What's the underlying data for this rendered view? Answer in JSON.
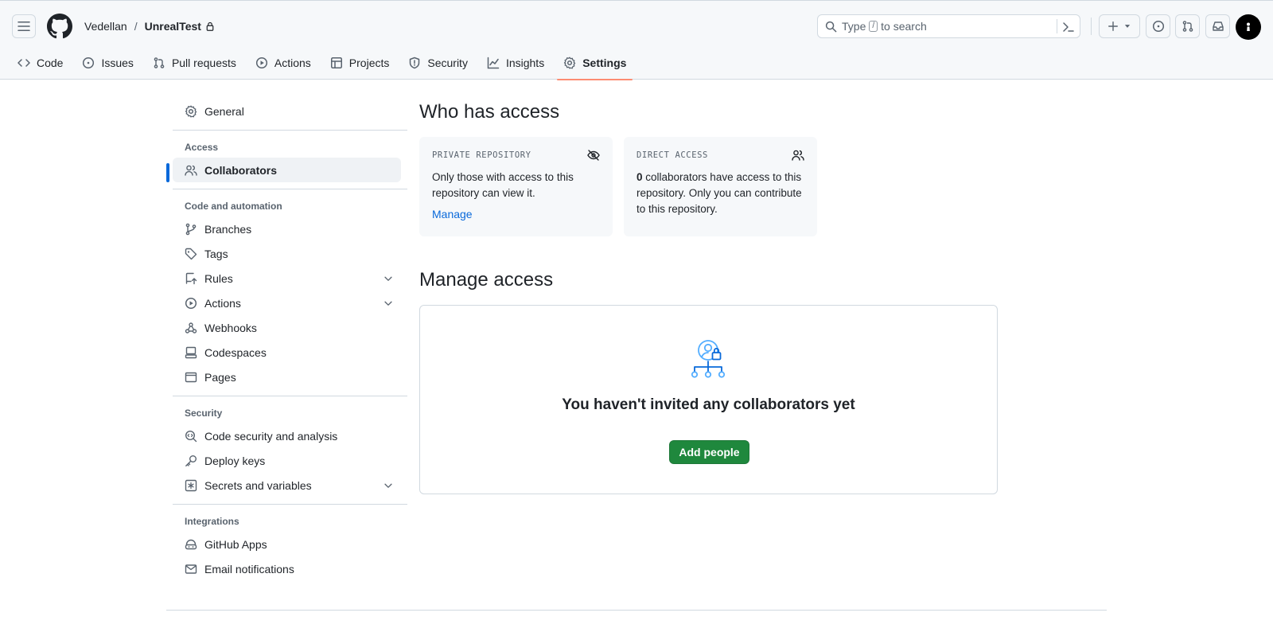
{
  "header": {
    "owner": "Vedellan",
    "separator": "/",
    "repo": "UnrealTest",
    "search": {
      "prefix": "Type",
      "key": "/",
      "suffix": "to search"
    },
    "icons": [
      "hamburger-icon",
      "github-logo-icon",
      "lock-icon",
      "search-icon",
      "command-palette-icon",
      "plus-icon",
      "triangle-down-icon",
      "issue-opened-icon",
      "git-pull-request-icon",
      "inbox-icon",
      "avatar"
    ]
  },
  "nav": {
    "tabs": [
      {
        "label": "Code",
        "icon": "code-icon"
      },
      {
        "label": "Issues",
        "icon": "issue-opened-icon"
      },
      {
        "label": "Pull requests",
        "icon": "git-pull-request-icon"
      },
      {
        "label": "Actions",
        "icon": "play-icon"
      },
      {
        "label": "Projects",
        "icon": "table-icon"
      },
      {
        "label": "Security",
        "icon": "shield-icon"
      },
      {
        "label": "Insights",
        "icon": "graph-icon"
      },
      {
        "label": "Settings",
        "icon": "gear-icon",
        "selected": true
      }
    ]
  },
  "sidebar": {
    "general": "General",
    "access_heading": "Access",
    "collaborators": "Collaborators",
    "code_heading": "Code and automation",
    "branches": "Branches",
    "tags": "Tags",
    "rules": "Rules",
    "actions": "Actions",
    "webhooks": "Webhooks",
    "codespaces": "Codespaces",
    "pages": "Pages",
    "security_heading": "Security",
    "code_security": "Code security and analysis",
    "deploy_keys": "Deploy keys",
    "secrets": "Secrets and variables",
    "integrations_heading": "Integrations",
    "github_apps": "GitHub Apps",
    "email_notifications": "Email notifications"
  },
  "main": {
    "who_title": "Who has access",
    "private_card": {
      "title": "PRIVATE REPOSITORY",
      "body": "Only those with access to this repository can view it.",
      "link": "Manage"
    },
    "direct_card": {
      "title": "DIRECT ACCESS",
      "count": "0",
      "body": " collaborators have access to this repository. Only you can contribute to this repository."
    },
    "manage_title": "Manage access",
    "blank_title": "You haven't invited any collaborators yet",
    "add_button": "Add people"
  },
  "colors": {
    "accent_blue": "#0969da",
    "selected_tab_underline": "#fd8c73",
    "primary_button": "#1f883d",
    "border": "#d1d9e0",
    "muted_text": "#59636e"
  }
}
